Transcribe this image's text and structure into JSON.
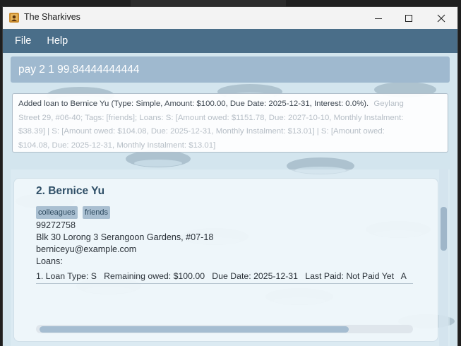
{
  "window": {
    "title": "The Sharkives"
  },
  "menu": {
    "file": "File",
    "help": "Help"
  },
  "command": {
    "value": "pay 2 1 99.84444444444"
  },
  "result": {
    "line1": "Added loan to Bernice Yu (Type: Simple, Amount: $100.00, Due Date: 2025-12-31, Interest: 0.0%).",
    "line1_overlap": "Geylang",
    "line2": "Street 29, #06-40; Tags: [friends]; Loans: S: [Amount owed: $1151.78, Due: 2027-10-10, Monthly Instalment:",
    "line3": "$38.39]  | S: [Amount owed: $104.08, Due: 2025-12-31, Monthly Instalment: $13.01]  | S: [Amount owed:",
    "line4": "$104.08, Due: 2025-12-31, Monthly Instalment: $13.01]"
  },
  "person": {
    "index_name": "2.  Bernice Yu",
    "tags": [
      "colleagues",
      "friends"
    ],
    "phone": "99272758",
    "address": "Blk 30 Lorong 3 Serangoon Gardens, #07-18",
    "email": "berniceyu@example.com",
    "loans_label": "Loans:",
    "loan_line": "1. Loan Type: S   Remaining owed: $100.00   Due Date: 2025-12-31   Last Paid: Not Paid Yet   A"
  },
  "colors": {
    "menubar": "#4a6e89",
    "command_bg": "#9fb9cf",
    "name": "#2f4f67",
    "tag_bg": "#a9bfd1"
  }
}
